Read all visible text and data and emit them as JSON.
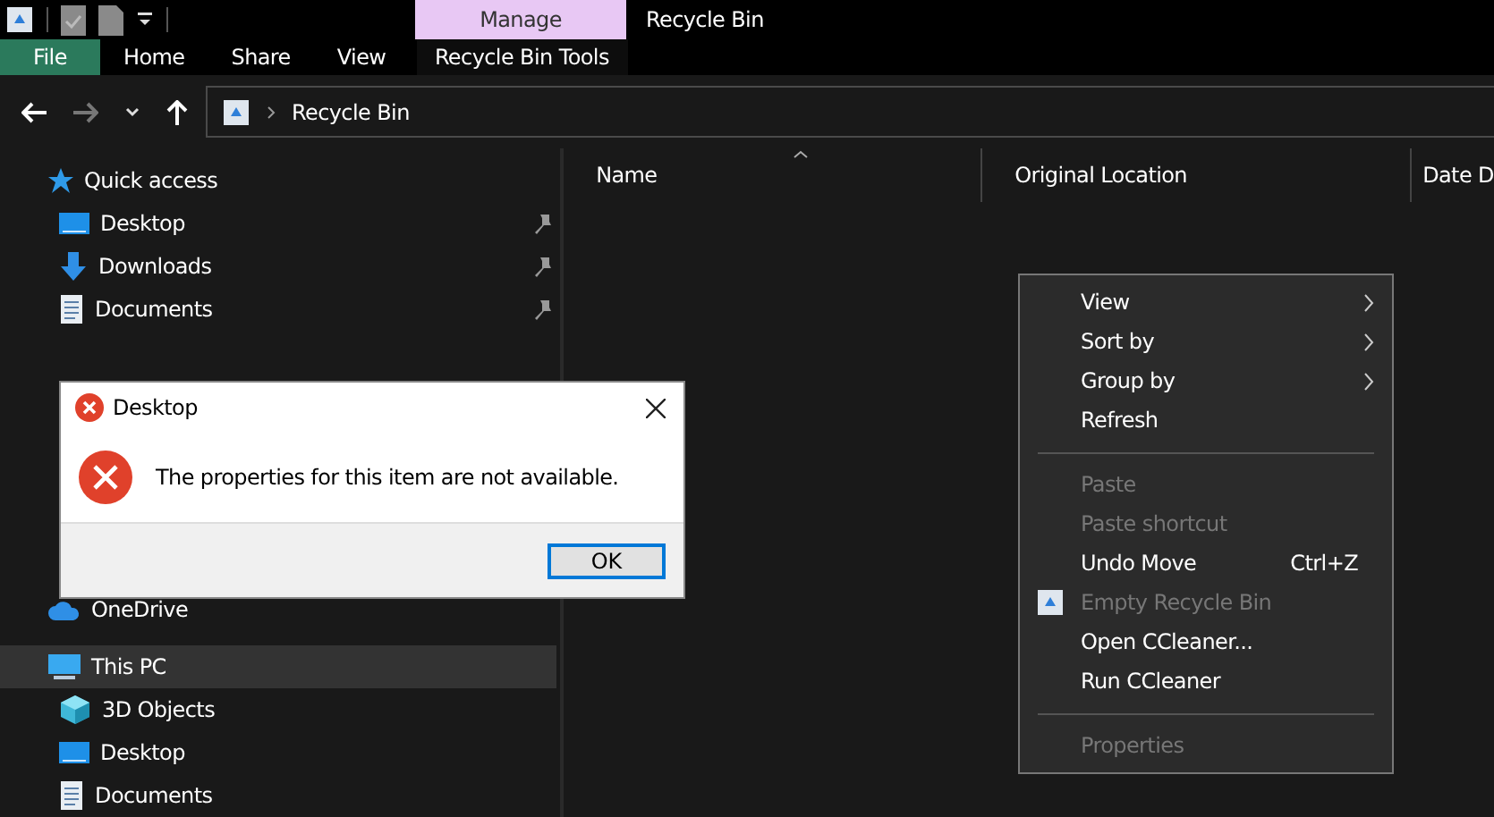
{
  "window": {
    "title": "Recycle Bin",
    "contextual_tab_group": "Manage"
  },
  "ribbon_tabs": [
    {
      "label": "File",
      "kind": "file"
    },
    {
      "label": "Home",
      "kind": "normal"
    },
    {
      "label": "Share",
      "kind": "normal"
    },
    {
      "label": "View",
      "kind": "normal"
    },
    {
      "label": "Recycle Bin Tools",
      "kind": "contextual"
    }
  ],
  "navigation": {
    "back_disabled": false,
    "forward_disabled": true,
    "address": "Recycle Bin"
  },
  "sidebar": {
    "quick_access": {
      "label": "Quick access",
      "items": [
        {
          "label": "Desktop",
          "pinned": true,
          "kind": "desktop"
        },
        {
          "label": "Downloads",
          "pinned": true,
          "kind": "downloads"
        },
        {
          "label": "Documents",
          "pinned": true,
          "kind": "documents"
        }
      ]
    },
    "onedrive": {
      "label": "OneDrive"
    },
    "this_pc": {
      "label": "This PC",
      "selected": true,
      "children": [
        {
          "label": "3D Objects",
          "kind": "objects"
        },
        {
          "label": "Desktop",
          "kind": "desktop"
        },
        {
          "label": "Documents",
          "kind": "documents"
        }
      ]
    }
  },
  "columns": [
    {
      "label": "Name",
      "sorted": true
    },
    {
      "label": "Original Location",
      "sorted": false
    },
    {
      "label": "Date D",
      "sorted": false
    }
  ],
  "context_menu": [
    {
      "kind": "item",
      "label": "View",
      "submenu": true,
      "disabled": false
    },
    {
      "kind": "item",
      "label": "Sort by",
      "submenu": true,
      "disabled": false
    },
    {
      "kind": "item",
      "label": "Group by",
      "submenu": true,
      "disabled": false
    },
    {
      "kind": "item",
      "label": "Refresh",
      "submenu": false,
      "disabled": false
    },
    {
      "kind": "separator"
    },
    {
      "kind": "item",
      "label": "Paste",
      "submenu": false,
      "disabled": true
    },
    {
      "kind": "item",
      "label": "Paste shortcut",
      "submenu": false,
      "disabled": true
    },
    {
      "kind": "item",
      "label": "Undo Move",
      "shortcut": "Ctrl+Z",
      "submenu": false,
      "disabled": false
    },
    {
      "kind": "item",
      "label": "Empty Recycle Bin",
      "submenu": false,
      "disabled": true,
      "has_icon": true
    },
    {
      "kind": "item",
      "label": "Open CCleaner...",
      "submenu": false,
      "disabled": false
    },
    {
      "kind": "item",
      "label": "Run CCleaner",
      "submenu": false,
      "disabled": false
    },
    {
      "kind": "separator"
    },
    {
      "kind": "item",
      "label": "Properties",
      "submenu": false,
      "disabled": true
    }
  ],
  "dialog": {
    "title": "Desktop",
    "message": "The properties for this item are not available.",
    "button": "OK"
  }
}
